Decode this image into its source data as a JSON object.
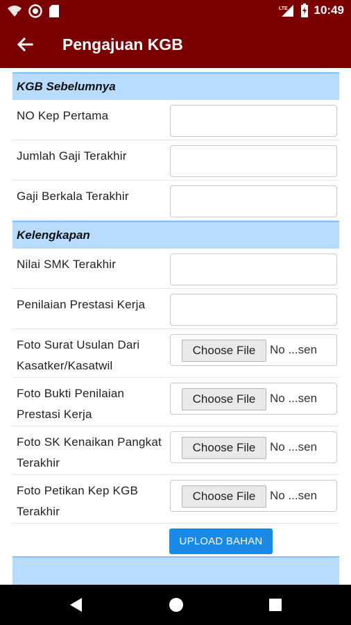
{
  "status_bar": {
    "time": "10:49",
    "left_icons": [
      "wifi-question-icon",
      "circle-record-icon",
      "sd-card-icon"
    ],
    "right_icons": [
      "lte-signal-icon",
      "battery-charging-icon"
    ]
  },
  "app_bar": {
    "title": "Pengajuan KGB",
    "back_icon": "arrow-left-icon"
  },
  "form": {
    "section1_title": "KGB Sebelumnya",
    "section2_title": "Kelengkapan",
    "fields": {
      "no_kep_pertama": {
        "label": "NO Kep Pertama",
        "value": ""
      },
      "jumlah_gaji_terakhir": {
        "label": "Jumlah Gaji Terakhir",
        "value": ""
      },
      "gaji_berkala_terakhir": {
        "label": "Gaji Berkala Terakhir",
        "value": ""
      },
      "nilai_smk_terakhir": {
        "label": "Nilai SMK Terakhir",
        "value": ""
      },
      "penilaian_prestasi_kerja": {
        "label": "Penilaian Prestasi Kerja",
        "value": ""
      }
    },
    "files": [
      {
        "label": "Foto Surat Usulan Dari Kasatker/Kasatwil",
        "button": "Choose File",
        "status": "No ...sen"
      },
      {
        "label": "Foto Bukti Penilaian Prestasi Kerja",
        "button": "Choose File",
        "status": "No ...sen"
      },
      {
        "label": "Foto SK Kenaikan Pangkat Terakhir",
        "button": "Choose File",
        "status": "No ...sen"
      },
      {
        "label": "Foto Petikan Kep KGB Terakhir",
        "button": "Choose File",
        "status": "No ...sen"
      }
    ],
    "upload_button": "UPLOAD BAHAN"
  },
  "nav_bar": {
    "icons": [
      "back-triangle-icon",
      "home-circle-icon",
      "recents-square-icon"
    ]
  },
  "colors": {
    "primary": "#7b0000",
    "section_bg": "#b8dcff",
    "button": "#1a8ae6"
  }
}
